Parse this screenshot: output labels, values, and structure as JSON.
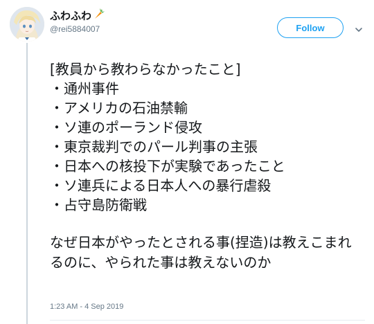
{
  "user": {
    "display_name": "ふわふわ",
    "handle": "@rei5884007",
    "emoji_icon": "carrot-icon"
  },
  "actions": {
    "follow_label": "Follow",
    "menu_icon": "chevron-down-icon"
  },
  "tweet": {
    "heading": "[教員から教わらなかったこと]",
    "items": [
      "・通州事件",
      "・アメリカの石油禁輸",
      "・ソ連のポーランド侵攻",
      "・東京裁判でのパール判事の主張",
      "・日本への核投下が実験であったこと",
      "・ソ連兵による日本人への暴行虐殺",
      "・占守島防衛戦"
    ],
    "closing": "なぜ日本がやったとされる事(捏造)は教えこまれるのに、やられた事は教えないのか",
    "timestamp": "1:23 AM - 4 Sep 2019"
  },
  "colors": {
    "accent": "#1da1f2",
    "text": "#14171a",
    "muted": "#657786",
    "thread_line": "#ccd6dd"
  }
}
